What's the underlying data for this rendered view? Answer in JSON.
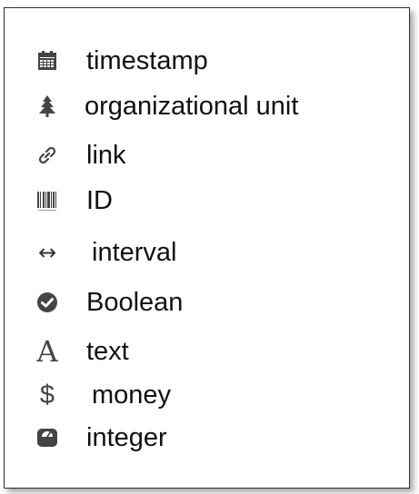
{
  "legend": {
    "items": [
      {
        "label": "timestamp",
        "icon": "calendar-icon"
      },
      {
        "label": "organizational unit",
        "icon": "tree-icon"
      },
      {
        "label": "link",
        "icon": "link-icon"
      },
      {
        "label": "ID",
        "icon": "barcode-icon"
      },
      {
        "label": "interval",
        "icon": "double-arrow-icon"
      },
      {
        "label": "Boolean",
        "icon": "check-circle-icon"
      },
      {
        "label": "text",
        "icon": "letter-a-icon"
      },
      {
        "label": "money",
        "icon": "dollar-icon"
      },
      {
        "label": "integer",
        "icon": "scale-icon"
      }
    ],
    "icon_color": "#444444",
    "border_color": "#2f2f2f"
  }
}
